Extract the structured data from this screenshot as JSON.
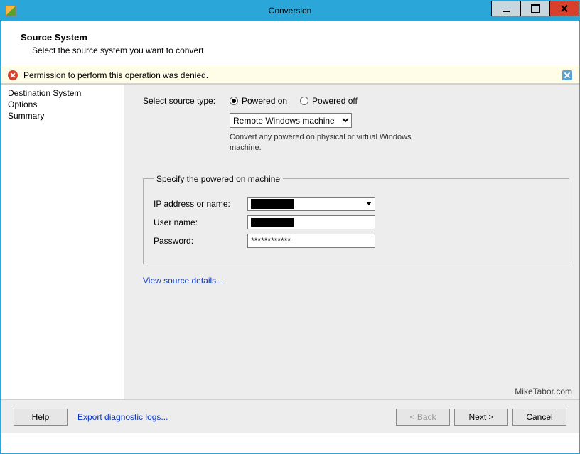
{
  "window": {
    "title": "Conversion"
  },
  "header": {
    "title": "Source System",
    "subtitle": "Select the source system you want to convert"
  },
  "alert": {
    "message": "Permission to perform this operation was denied."
  },
  "sidebar": {
    "items": [
      "Destination System",
      "Options",
      "Summary"
    ]
  },
  "form": {
    "source_type_label": "Select source type:",
    "radio_on": "Powered on",
    "radio_off": "Powered off",
    "machine_type": "Remote Windows machine",
    "machine_hint": "Convert any powered on physical or virtual Windows machine.",
    "group_legend": "Specify the powered on machine",
    "ip_label": "IP address or name:",
    "user_label": "User name:",
    "pass_label": "Password:",
    "pass_value": "************",
    "view_details": "View source details..."
  },
  "watermark": "MikeTabor.com",
  "footer": {
    "help": "Help",
    "export": "Export diagnostic logs...",
    "back": "< Back",
    "next": "Next >",
    "cancel": "Cancel"
  }
}
